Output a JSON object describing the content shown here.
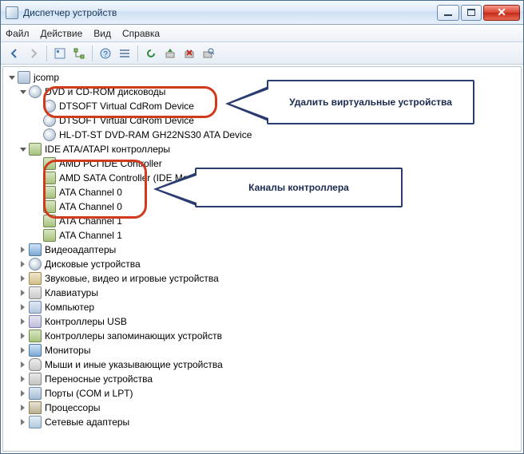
{
  "window": {
    "title": "Диспетчер устройств"
  },
  "menu": {
    "file": "Файл",
    "action": "Действие",
    "view": "Вид",
    "help": "Справка"
  },
  "toolbar_icons": [
    "back-icon",
    "forward-icon",
    "properties-icon",
    "tree-icon",
    "help-icon",
    "grid-icon",
    "list-icon",
    "refresh-icon",
    "scan-icon",
    "remove-icon",
    "scan2-icon"
  ],
  "callouts": {
    "remove_virtual": "Удалить виртуальные устройства",
    "controller_channels": "Каналы контроллера"
  },
  "tree": {
    "root": "jcomp",
    "categories": [
      {
        "label": "DVD и CD-ROM дисководы",
        "expanded": true,
        "icon": "disc",
        "children": [
          {
            "label": "DTSOFT Virtual CdRom Device",
            "icon": "disc"
          },
          {
            "label": "DTSOFT Virtual CdRom Device",
            "icon": "disc"
          },
          {
            "label": "HL-DT-ST DVD-RAM GH22NS30 ATA Device",
            "icon": "disc"
          }
        ]
      },
      {
        "label": "IDE ATA/ATAPI контроллеры",
        "expanded": true,
        "icon": "ctrl",
        "children": [
          {
            "label": "AMD PCI IDE Controller",
            "icon": "ctrl"
          },
          {
            "label": "AMD SATA Controller (IDE Mode)",
            "icon": "ctrl"
          },
          {
            "label": "ATA Channel 0",
            "icon": "ctrl"
          },
          {
            "label": "ATA Channel 0",
            "icon": "ctrl"
          },
          {
            "label": "ATA Channel 1",
            "icon": "ctrl"
          },
          {
            "label": "ATA Channel 1",
            "icon": "ctrl"
          }
        ]
      },
      {
        "label": "Видеоадаптеры",
        "expanded": false,
        "icon": "mon"
      },
      {
        "label": "Дисковые устройства",
        "expanded": false,
        "icon": "disc"
      },
      {
        "label": "Звуковые, видео и игровые устройства",
        "expanded": false,
        "icon": "snd"
      },
      {
        "label": "Клавиатуры",
        "expanded": false,
        "icon": "kb"
      },
      {
        "label": "Компьютер",
        "expanded": false,
        "icon": "comp"
      },
      {
        "label": "Контроллеры USB",
        "expanded": false,
        "icon": "usb"
      },
      {
        "label": "Контроллеры запоминающих устройств",
        "expanded": false,
        "icon": "ctrl"
      },
      {
        "label": "Мониторы",
        "expanded": false,
        "icon": "mon"
      },
      {
        "label": "Мыши и иные указывающие устройства",
        "expanded": false,
        "icon": "mouse"
      },
      {
        "label": "Переносные устройства",
        "expanded": false,
        "icon": "dev"
      },
      {
        "label": "Порты (COM и LPT)",
        "expanded": false,
        "icon": "port"
      },
      {
        "label": "Процессоры",
        "expanded": false,
        "icon": "cpu"
      },
      {
        "label": "Сетевые адаптеры",
        "expanded": false,
        "icon": "net"
      }
    ]
  }
}
